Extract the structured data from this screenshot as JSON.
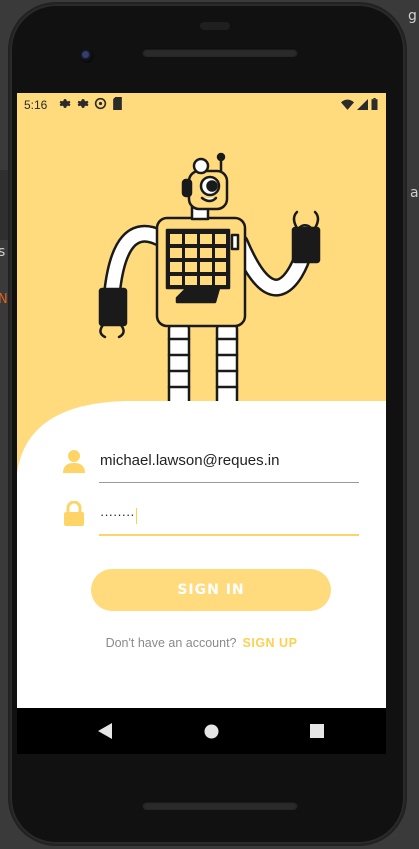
{
  "status_bar": {
    "time": "5:16",
    "left_icons": [
      "settings-icon",
      "settings-icon",
      "sync-icon",
      "sd-card-icon"
    ],
    "right_icons": [
      "wifi-icon",
      "signal-icon",
      "battery-icon"
    ]
  },
  "login": {
    "email_value": "michael.lawson@reques.in",
    "password_value": "········",
    "signin_label": "SIGN IN",
    "signup_prompt": "Don't have an account?",
    "signup_link": "SIGN UP"
  },
  "nav": {
    "back": "back-icon",
    "home": "home-icon",
    "recents": "recents-icon"
  },
  "colors": {
    "accent": "#ffdb7d",
    "link": "#ffcf52",
    "background": "#ffffff"
  }
}
